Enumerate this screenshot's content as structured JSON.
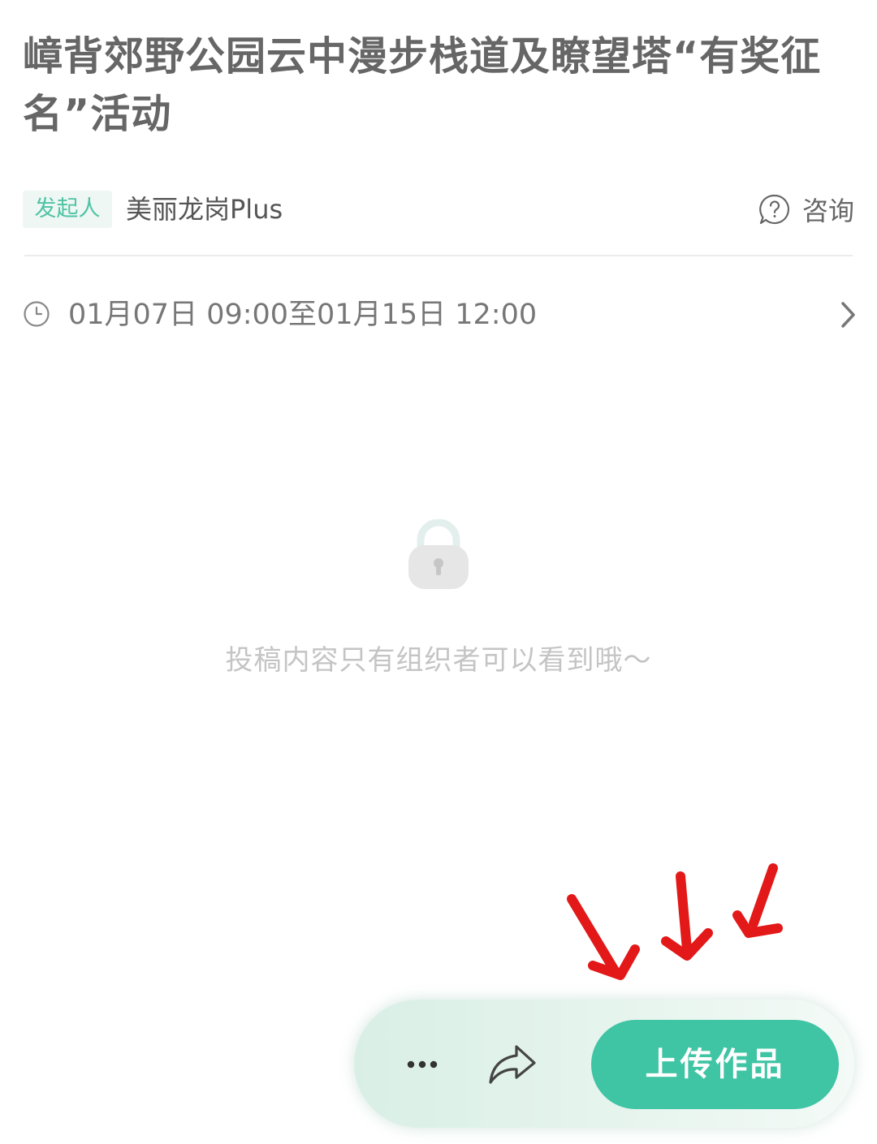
{
  "header": {
    "title": "嶂背郊野公园云中漫步栈道及瞭望塔“有奖征名”活动"
  },
  "organizer": {
    "tag_label": "发起人",
    "name": "美丽龙岗Plus"
  },
  "consult": {
    "icon": "question-circle-icon",
    "label": "咨询"
  },
  "schedule": {
    "icon": "clock-icon",
    "time_range": "01月07日 09:00至01月15日 12:00"
  },
  "submissions": {
    "icon": "lock-icon",
    "empty_message": "投稿内容只有组织者可以看到哦～"
  },
  "annotation": {
    "arrows_color": "#e02020",
    "arrow_count": 3
  },
  "action_bar": {
    "more_icon": "more-dots-icon",
    "share_icon": "share-arrow-icon",
    "upload_label": "上传作品"
  },
  "colors": {
    "accent": "#3fc4a4",
    "tag_bg": "#eef7f4",
    "tag_text": "#4fc3a4"
  }
}
